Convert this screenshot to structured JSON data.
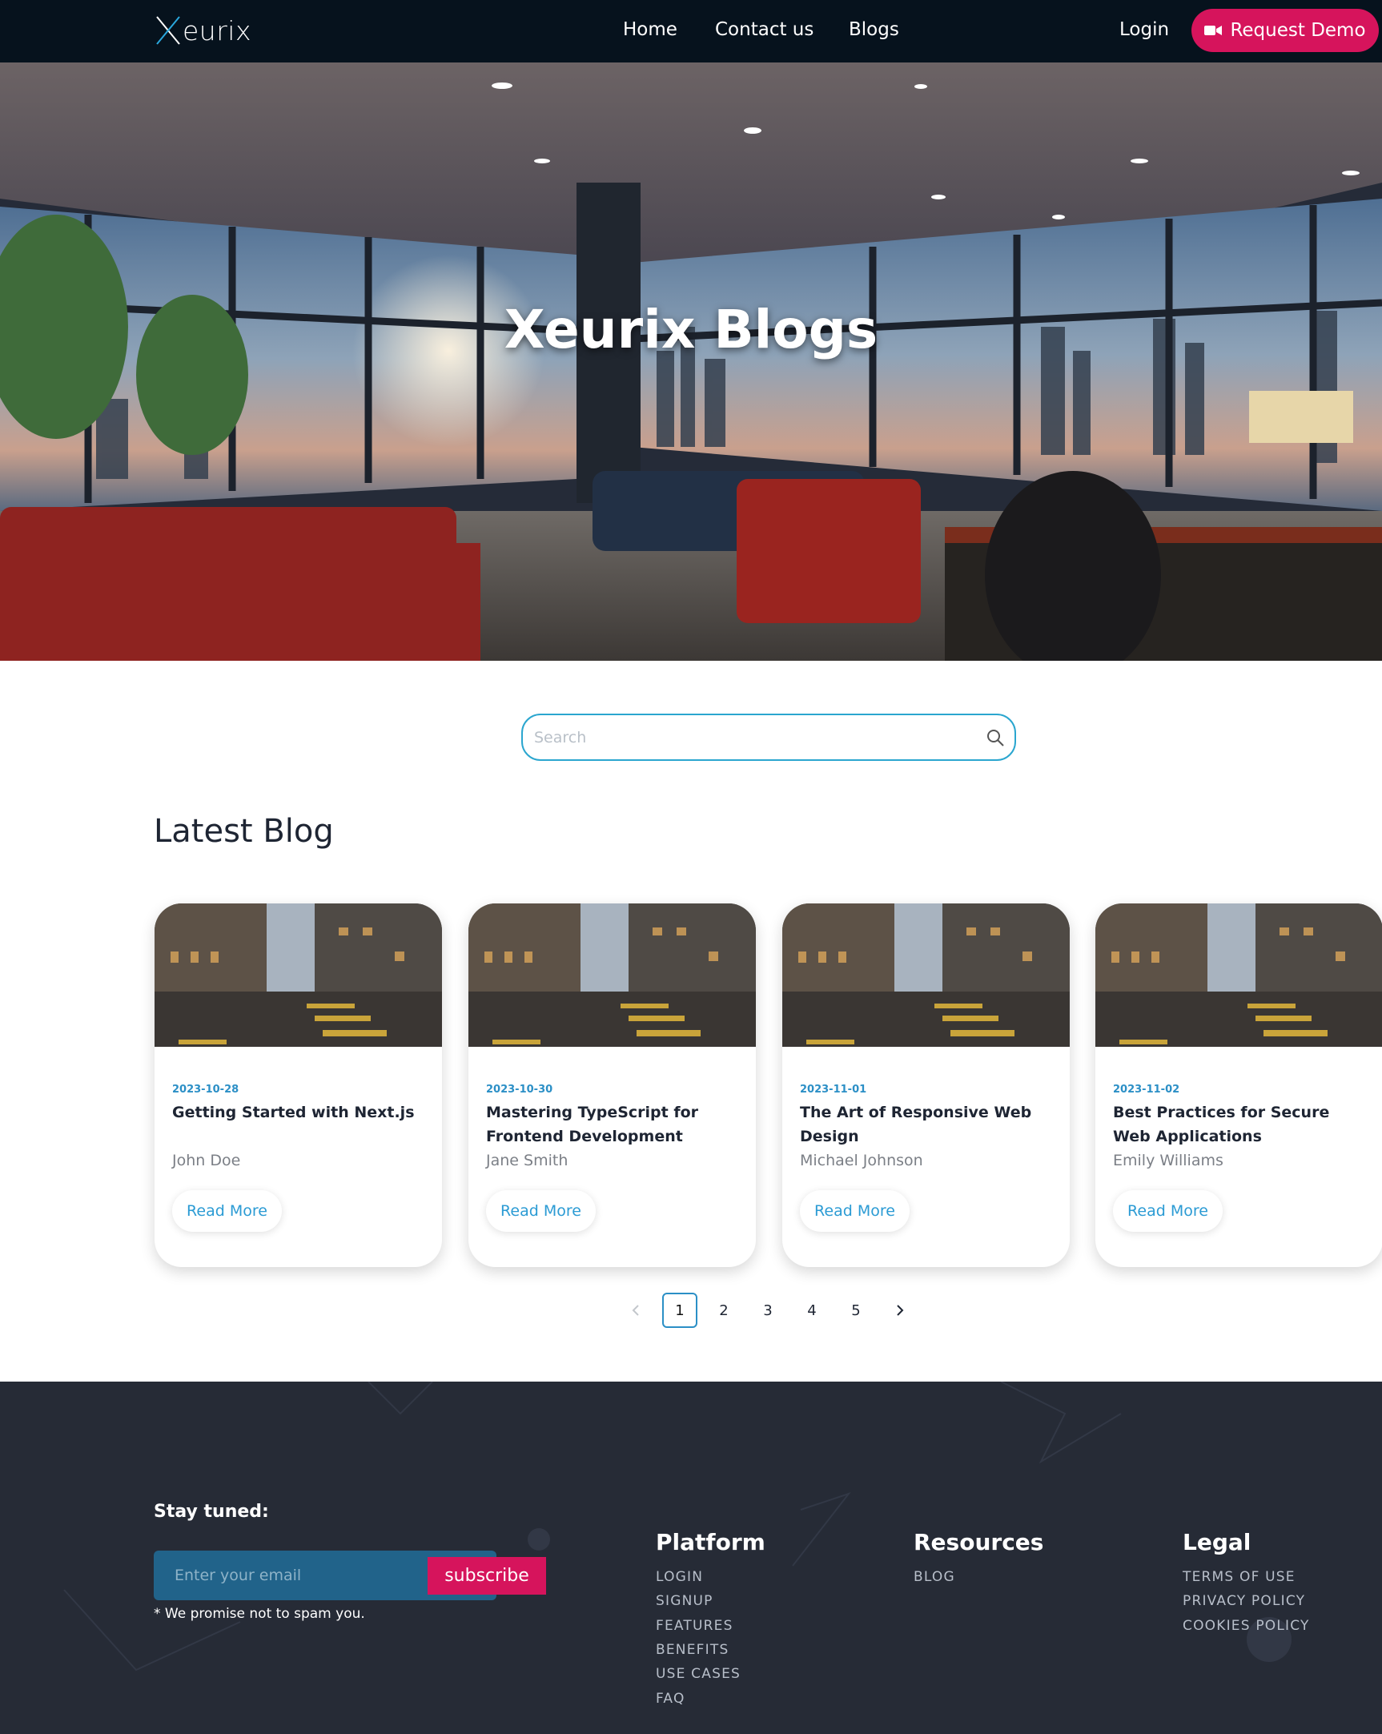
{
  "nav": {
    "logo_text": "eurix",
    "links": [
      "Home",
      "Contact us",
      "Blogs"
    ],
    "login": "Login",
    "demo": "Request Demo"
  },
  "hero": {
    "title": "Xeurix Blogs"
  },
  "search": {
    "placeholder": "Search"
  },
  "section": {
    "title": "Latest Blog"
  },
  "cards": [
    {
      "date": "2023-10-28",
      "title": "Getting Started with Next.js",
      "author": "John Doe",
      "button": "Read More"
    },
    {
      "date": "2023-10-30",
      "title": "Mastering TypeScript for Frontend Development",
      "author": "Jane Smith",
      "button": "Read More"
    },
    {
      "date": "2023-11-01",
      "title": "The Art of Responsive Web Design",
      "author": "Michael Johnson",
      "button": "Read More"
    },
    {
      "date": "2023-11-02",
      "title": "Best Practices for Secure Web Applications",
      "author": "Emily Williams",
      "button": "Read More"
    }
  ],
  "pagination": {
    "pages": [
      "1",
      "2",
      "3",
      "4",
      "5"
    ],
    "current": "1",
    "prev_icon": "chevron-left-icon",
    "next_icon": "chevron-right-icon"
  },
  "footer": {
    "stay_tuned": "Stay tuned:",
    "email_placeholder": "Enter your email",
    "subscribe": "subscribe",
    "promise": "* We promise not to spam you.",
    "columns": [
      {
        "heading": "Platform",
        "links": [
          "LOGIN",
          "SIGNUP",
          "FEATURES",
          "BENEFITS",
          "USE CASES",
          "FAQ"
        ]
      },
      {
        "heading": "Resources",
        "links": [
          "BLOG"
        ]
      },
      {
        "heading": "Legal",
        "links": [
          "TERMS OF USE",
          "PRIVACY POLICY",
          "COOKIES POLICY"
        ]
      }
    ]
  },
  "colors": {
    "nav_bg": "#06121d",
    "accent": "#d6145c",
    "link_blue": "#2b9bd4",
    "footer_bg": "#262b36"
  }
}
